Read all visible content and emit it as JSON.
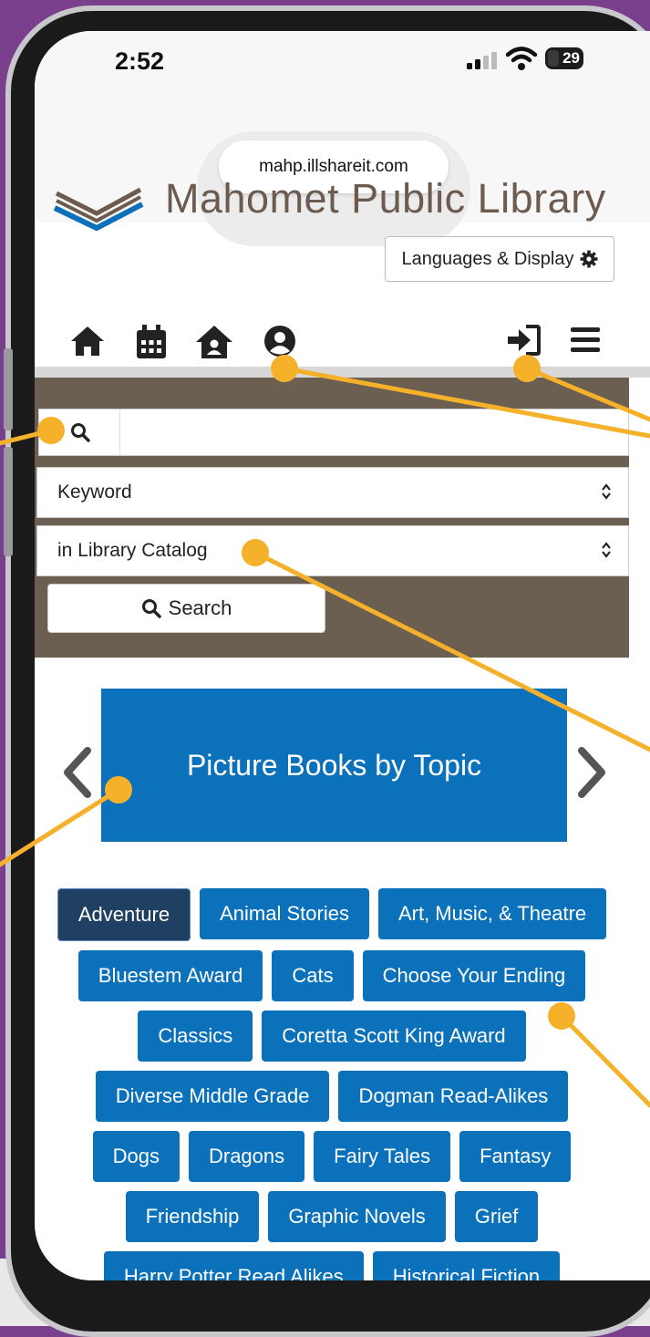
{
  "status_bar": {
    "time": "2:52",
    "battery": "29"
  },
  "browser": {
    "url": "mahp.illshareit.com"
  },
  "header": {
    "library_name": "Mahomet Public Library",
    "languages_button": "Languages & Display"
  },
  "nav_icons": [
    "home-icon",
    "calendar-icon",
    "library-home-icon",
    "account-icon",
    "login-icon",
    "menu-icon"
  ],
  "search": {
    "input_value": "",
    "type_select": "Keyword",
    "scope_select": "in Library Catalog",
    "button_label": "Search"
  },
  "carousel": {
    "title": "Picture Books by Topic"
  },
  "topics": [
    [
      "Adventure",
      "Animal Stories",
      "Art, Music, & Theatre"
    ],
    [
      "Bluestem Award",
      "Cats",
      "Choose Your Ending"
    ],
    [
      "Classics",
      "Coretta Scott King Award"
    ],
    [
      "Diverse Middle Grade",
      "Dogman Read-Alikes"
    ],
    [
      "Dogs",
      "Dragons",
      "Fairy Tales",
      "Fantasy"
    ],
    [
      "Friendship",
      "Graphic Novels",
      "Grief"
    ],
    [
      "Harry Potter Read Alikes",
      "Historical Fiction"
    ]
  ],
  "active_topic": "Adventure",
  "colors": {
    "brand_blue": "#0c71bb",
    "panel_brown": "#6b5f52",
    "annotation": "#f6b12a",
    "background": "#7a3f8c"
  }
}
